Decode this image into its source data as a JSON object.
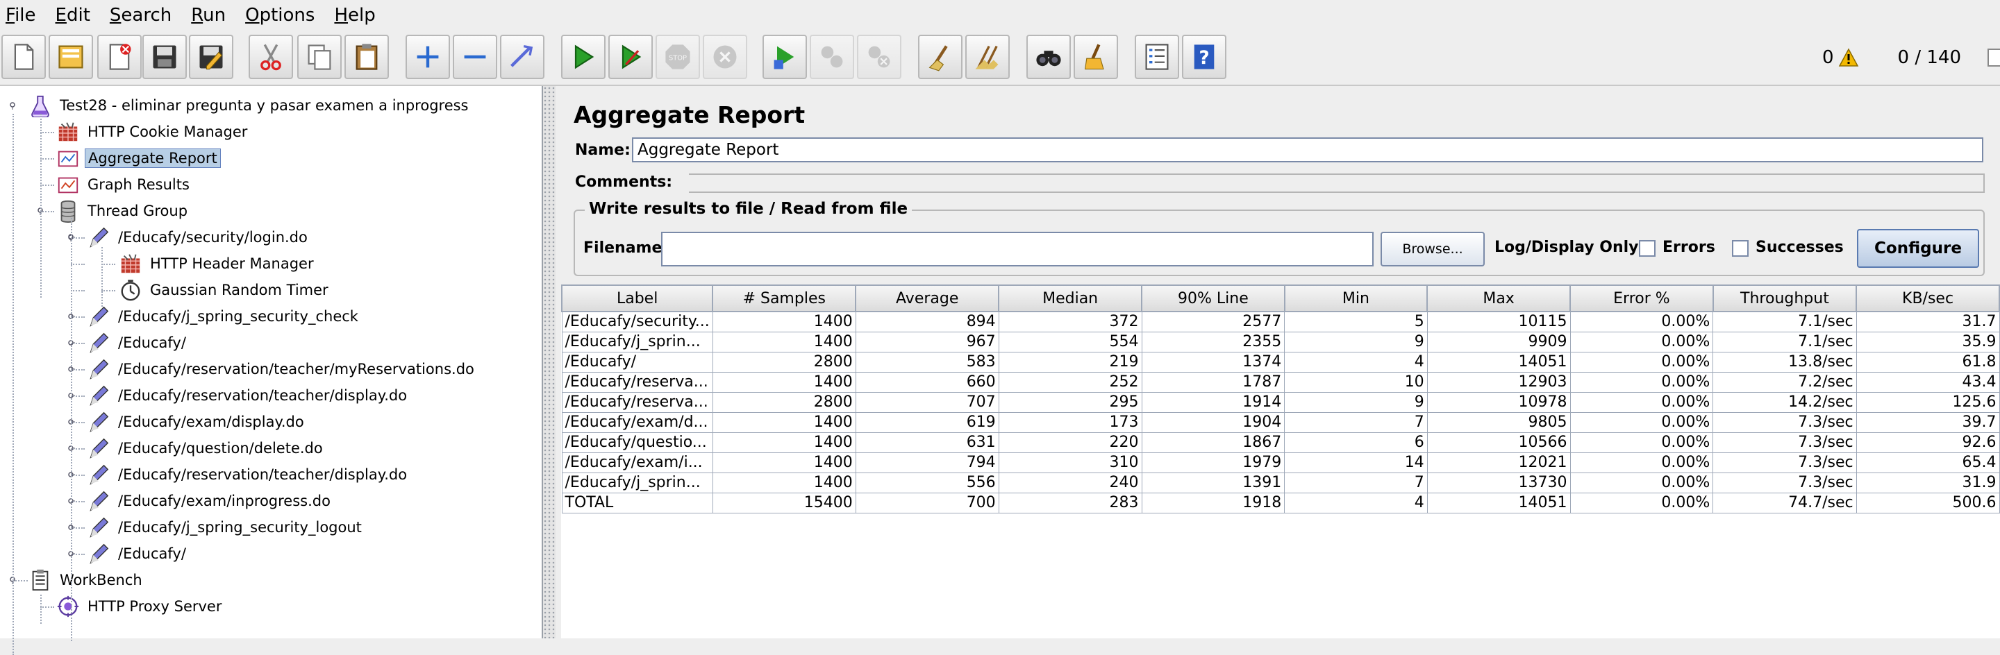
{
  "menu": [
    {
      "label": "File",
      "mnemonic": "F"
    },
    {
      "label": "Edit",
      "mnemonic": "E"
    },
    {
      "label": "Search",
      "mnemonic": "S"
    },
    {
      "label": "Run",
      "mnemonic": "R"
    },
    {
      "label": "Options",
      "mnemonic": "O"
    },
    {
      "label": "Help",
      "mnemonic": "H"
    }
  ],
  "toolbar": {
    "buttons": [
      {
        "icon": "new-icon"
      },
      {
        "icon": "templates-icon"
      },
      {
        "icon": "open-icon"
      },
      {
        "icon": "close-icon"
      },
      {
        "icon": "save-icon"
      },
      {
        "icon": "save-as-icon"
      },
      {
        "icon": "cut-icon"
      },
      {
        "icon": "copy-icon"
      },
      {
        "icon": "paste-icon"
      },
      {
        "icon": "expand-icon"
      },
      {
        "icon": "collapse-icon"
      },
      {
        "icon": "toggle-icon"
      },
      {
        "icon": "start-icon"
      },
      {
        "icon": "start-no-pause-icon"
      },
      {
        "icon": "stop-icon"
      },
      {
        "icon": "shutdown-icon"
      },
      {
        "icon": "remote-start-icon"
      },
      {
        "icon": "remote-stop-icon"
      },
      {
        "icon": "remote-shutdown-icon"
      },
      {
        "icon": "clear-icon"
      },
      {
        "icon": "clear-all-icon"
      },
      {
        "icon": "search-icon"
      },
      {
        "icon": "reset-search-icon"
      },
      {
        "icon": "function-helper-icon"
      },
      {
        "icon": "help-icon"
      }
    ],
    "error_count": "0",
    "threads": "0 / 140"
  },
  "tree": [
    {
      "label": "Test28 - eliminar pregunta y pasar examen a inprogress",
      "icon": "test-plan-icon",
      "selected": false
    },
    {
      "label": "HTTP Cookie Manager",
      "icon": "cookie-manager-icon",
      "selected": false
    },
    {
      "label": "Aggregate Report",
      "icon": "aggregate-report-icon",
      "selected": true
    },
    {
      "label": "Graph Results",
      "icon": "graph-results-icon",
      "selected": false
    },
    {
      "label": "Thread Group",
      "icon": "thread-group-icon",
      "selected": false
    },
    {
      "label": "/Educafy/security/login.do",
      "icon": "sampler-icon",
      "selected": false
    },
    {
      "label": "HTTP Header Manager",
      "icon": "header-manager-icon",
      "selected": false
    },
    {
      "label": "Gaussian Random Timer",
      "icon": "timer-icon",
      "selected": false
    },
    {
      "label": "/Educafy/j_spring_security_check",
      "icon": "sampler-icon",
      "selected": false
    },
    {
      "label": "/Educafy/",
      "icon": "sampler-icon",
      "selected": false
    },
    {
      "label": "/Educafy/reservation/teacher/myReservations.do",
      "icon": "sampler-icon",
      "selected": false
    },
    {
      "label": "/Educafy/reservation/teacher/display.do",
      "icon": "sampler-icon",
      "selected": false
    },
    {
      "label": "/Educafy/exam/display.do",
      "icon": "sampler-icon",
      "selected": false
    },
    {
      "label": "/Educafy/question/delete.do",
      "icon": "sampler-icon",
      "selected": false
    },
    {
      "label": "/Educafy/reservation/teacher/display.do",
      "icon": "sampler-icon",
      "selected": false
    },
    {
      "label": "/Educafy/exam/inprogress.do",
      "icon": "sampler-icon",
      "selected": false
    },
    {
      "label": "/Educafy/j_spring_security_logout",
      "icon": "sampler-icon",
      "selected": false
    },
    {
      "label": "/Educafy/",
      "icon": "sampler-icon",
      "selected": false
    },
    {
      "label": "WorkBench",
      "icon": "workbench-icon",
      "selected": false
    },
    {
      "label": "HTTP Proxy Server",
      "icon": "proxy-server-icon",
      "selected": false
    }
  ],
  "panel": {
    "title": "Aggregate Report",
    "name_label": "Name:",
    "name_value": "Aggregate Report",
    "comments_label": "Comments:",
    "file_group_title": "Write results to file / Read from file",
    "filename_label": "Filename",
    "filename_value": "",
    "browse_label": "Browse...",
    "log_display_label": "Log/Display Only:",
    "errors_label": "Errors",
    "errors_checked": false,
    "successes_label": "Successes",
    "successes_checked": false,
    "configure_label": "Configure"
  },
  "table": {
    "columns": [
      "Label",
      "# Samples",
      "Average",
      "Median",
      "90% Line",
      "Min",
      "Max",
      "Error %",
      "Throughput",
      "KB/sec"
    ],
    "rows": [
      [
        "/Educafy/security...",
        "1400",
        "894",
        "372",
        "2577",
        "5",
        "10115",
        "0.00%",
        "7.1/sec",
        "31.7"
      ],
      [
        "/Educafy/j_sprin...",
        "1400",
        "967",
        "554",
        "2355",
        "9",
        "9909",
        "0.00%",
        "7.1/sec",
        "35.9"
      ],
      [
        "/Educafy/",
        "2800",
        "583",
        "219",
        "1374",
        "4",
        "14051",
        "0.00%",
        "13.8/sec",
        "61.8"
      ],
      [
        "/Educafy/reserva...",
        "1400",
        "660",
        "252",
        "1787",
        "10",
        "12903",
        "0.00%",
        "7.2/sec",
        "43.4"
      ],
      [
        "/Educafy/reserva...",
        "2800",
        "707",
        "295",
        "1914",
        "9",
        "10978",
        "0.00%",
        "14.2/sec",
        "125.6"
      ],
      [
        "/Educafy/exam/d...",
        "1400",
        "619",
        "173",
        "1904",
        "7",
        "9805",
        "0.00%",
        "7.3/sec",
        "39.7"
      ],
      [
        "/Educafy/questio...",
        "1400",
        "631",
        "220",
        "1867",
        "6",
        "10566",
        "0.00%",
        "7.3/sec",
        "92.6"
      ],
      [
        "/Educafy/exam/i...",
        "1400",
        "794",
        "310",
        "1979",
        "14",
        "12021",
        "0.00%",
        "7.3/sec",
        "65.4"
      ],
      [
        "/Educafy/j_sprin...",
        "1400",
        "556",
        "240",
        "1391",
        "7",
        "13730",
        "0.00%",
        "7.3/sec",
        "31.9"
      ],
      [
        "TOTAL",
        "15400",
        "700",
        "283",
        "1918",
        "4",
        "14051",
        "0.00%",
        "74.7/sec",
        "500.6"
      ]
    ]
  }
}
